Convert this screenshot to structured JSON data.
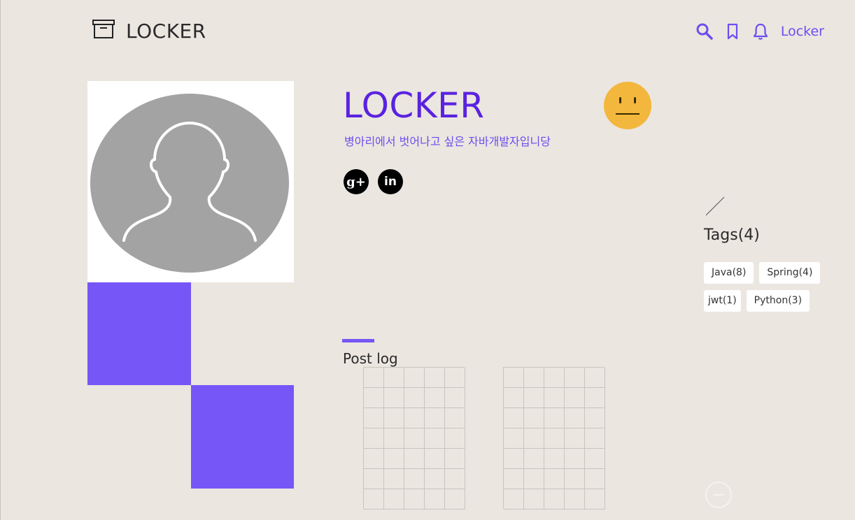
{
  "header": {
    "logo_text": "LOCKER",
    "user_label": "Locker",
    "icons": [
      "archive-box-icon",
      "search-icon",
      "bookmark-icon",
      "bell-icon"
    ]
  },
  "profile": {
    "name": "LOCKER",
    "bio": "병아리에서 벗어나고 싶은 자바개발자입니당",
    "avatar": "user-silhouette-icon",
    "mood": "neutral-face-icon",
    "social": [
      {
        "name": "google-plus-icon",
        "label": "g+"
      },
      {
        "name": "linkedin-icon",
        "label": "in"
      }
    ]
  },
  "tags": {
    "title": "Tags(4)",
    "items": [
      "Java(8)",
      "Spring(4)",
      "jwt(1)",
      "Python(3)"
    ]
  },
  "post_log": {
    "title": "Post log"
  },
  "colors": {
    "accent": "#7656f6",
    "title": "#5a22e0",
    "background": "#ebe6e0",
    "emoji": "#f2b73c"
  }
}
